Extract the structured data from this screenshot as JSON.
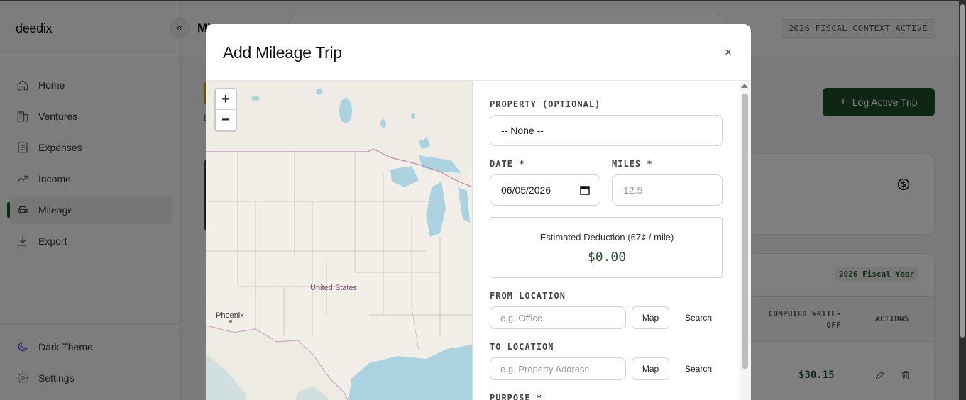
{
  "sidebar": {
    "brand": "deedix",
    "collapse_icon": "«",
    "items": [
      {
        "label": "Home",
        "icon": "home-icon",
        "active": false
      },
      {
        "label": "Ventures",
        "icon": "building-icon",
        "active": false
      },
      {
        "label": "Expenses",
        "icon": "receipt-icon",
        "active": false
      },
      {
        "label": "Income",
        "icon": "trending-up-icon",
        "active": false
      },
      {
        "label": "Mileage",
        "icon": "car-icon",
        "active": true
      },
      {
        "label": "Export",
        "icon": "download-icon",
        "active": false
      }
    ],
    "bottom_items": [
      {
        "label": "Dark Theme",
        "icon": "moon-icon"
      },
      {
        "label": "Settings",
        "icon": "gear-icon"
      }
    ]
  },
  "header": {
    "page_title_visible": "Mi",
    "fiscal_context": "2026 FISCAL CONTEXT ACTIVE"
  },
  "page": {
    "log_trip_button": "Log Active Trip",
    "fiscal_year_badge": "2026 Fiscal Year",
    "table": {
      "col_write_off": "COMPUTED WRITE-OFF",
      "col_write_off_line1": "COMPUTED WRITE-",
      "col_write_off_line2": "OFF",
      "col_actions": "ACTIONS",
      "rows": [
        {
          "write_off": "$30.15"
        }
      ]
    },
    "sub_letter": "L"
  },
  "modal": {
    "title": "Add Mileage Trip",
    "close_icon": "×",
    "map": {
      "zoom_in": "+",
      "zoom_out": "−",
      "labels": {
        "country": "United States",
        "city": "Phoenix"
      }
    },
    "form": {
      "property_label": "PROPERTY (OPTIONAL)",
      "property_value": "-- None --",
      "date_label": "DATE *",
      "date_value": "06/05/2026",
      "miles_label": "MILES *",
      "miles_placeholder": "12.5",
      "deduction_title": "Estimated Deduction (67¢ / mile)",
      "deduction_value": "$0.00",
      "from_label": "FROM LOCATION",
      "from_placeholder": "e.g. Office",
      "to_label": "TO LOCATION",
      "to_placeholder": "e.g. Property Address",
      "map_button": "Map",
      "search_button": "Search",
      "purpose_label": "PURPOSE *"
    }
  },
  "colors": {
    "brand_green": "#1e4d2b",
    "deduction_green": "#2f5a3a",
    "water": "#aad3df",
    "land": "#f2efe9"
  }
}
